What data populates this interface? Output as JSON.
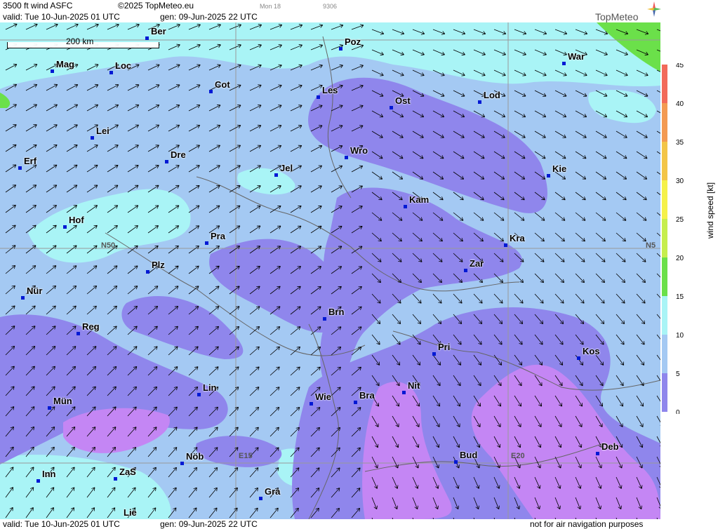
{
  "header": {
    "product": "3500 ft wind ASFC",
    "copyright": "©2025 TopMeteo.eu",
    "model_tag": "Mon 18",
    "code": "9306",
    "valid": "valid:  Tue  10-Jun-2025  01 UTC",
    "gen": "gen: 09-Jun-2025 22 UTC",
    "logo_text": "TopMeteo"
  },
  "scale_bar": {
    "label": "200 km"
  },
  "cities": [
    {
      "name": "Ber"
    },
    {
      "name": "Poz"
    },
    {
      "name": "War"
    },
    {
      "name": "Mag"
    },
    {
      "name": "Loc"
    },
    {
      "name": "Cot"
    },
    {
      "name": "Les"
    },
    {
      "name": "Ost"
    },
    {
      "name": "Lod"
    },
    {
      "name": "Lei"
    },
    {
      "name": "Erf"
    },
    {
      "name": "Dre"
    },
    {
      "name": "Wro"
    },
    {
      "name": "Jel"
    },
    {
      "name": "Kie"
    },
    {
      "name": "Kam"
    },
    {
      "name": "Hof"
    },
    {
      "name": "Pra"
    },
    {
      "name": "Kra"
    },
    {
      "name": "Zar"
    },
    {
      "name": "Plz"
    },
    {
      "name": "Nür"
    },
    {
      "name": "Brn"
    },
    {
      "name": "Reg"
    },
    {
      "name": "Pri"
    },
    {
      "name": "Kos"
    },
    {
      "name": "Nit"
    },
    {
      "name": "Lin"
    },
    {
      "name": "Mün"
    },
    {
      "name": "Wie"
    },
    {
      "name": "Bra"
    },
    {
      "name": "Deb"
    },
    {
      "name": "Nöb"
    },
    {
      "name": "Bud"
    },
    {
      "name": "Inn"
    },
    {
      "name": "ZaS"
    },
    {
      "name": "Gra"
    },
    {
      "name": "Lie"
    }
  ],
  "grid_labels": {
    "n50": "N50",
    "n50_right": "N5",
    "e15": "E15",
    "e20": "E20"
  },
  "legend": {
    "title": "wind  speed  [kt]",
    "unit": "kt",
    "ticks": [
      "45",
      "40",
      "35",
      "30",
      "25",
      "20",
      "15",
      "10",
      "5",
      "0"
    ],
    "colors": [
      "#f26a5a",
      "#f39a52",
      "#f3c548",
      "#f5f14a",
      "#c6ee4e",
      "#6be04a",
      "#a9f4f6",
      "#a4c9f3",
      "#8f86ec",
      "#c486f4"
    ]
  },
  "footer": {
    "valid": "valid:  Tue  10-Jun-2025  01 UTC",
    "gen": "gen: 09-Jun-2025 22 UTC",
    "disclaimer": "not for air navigation purposes"
  }
}
